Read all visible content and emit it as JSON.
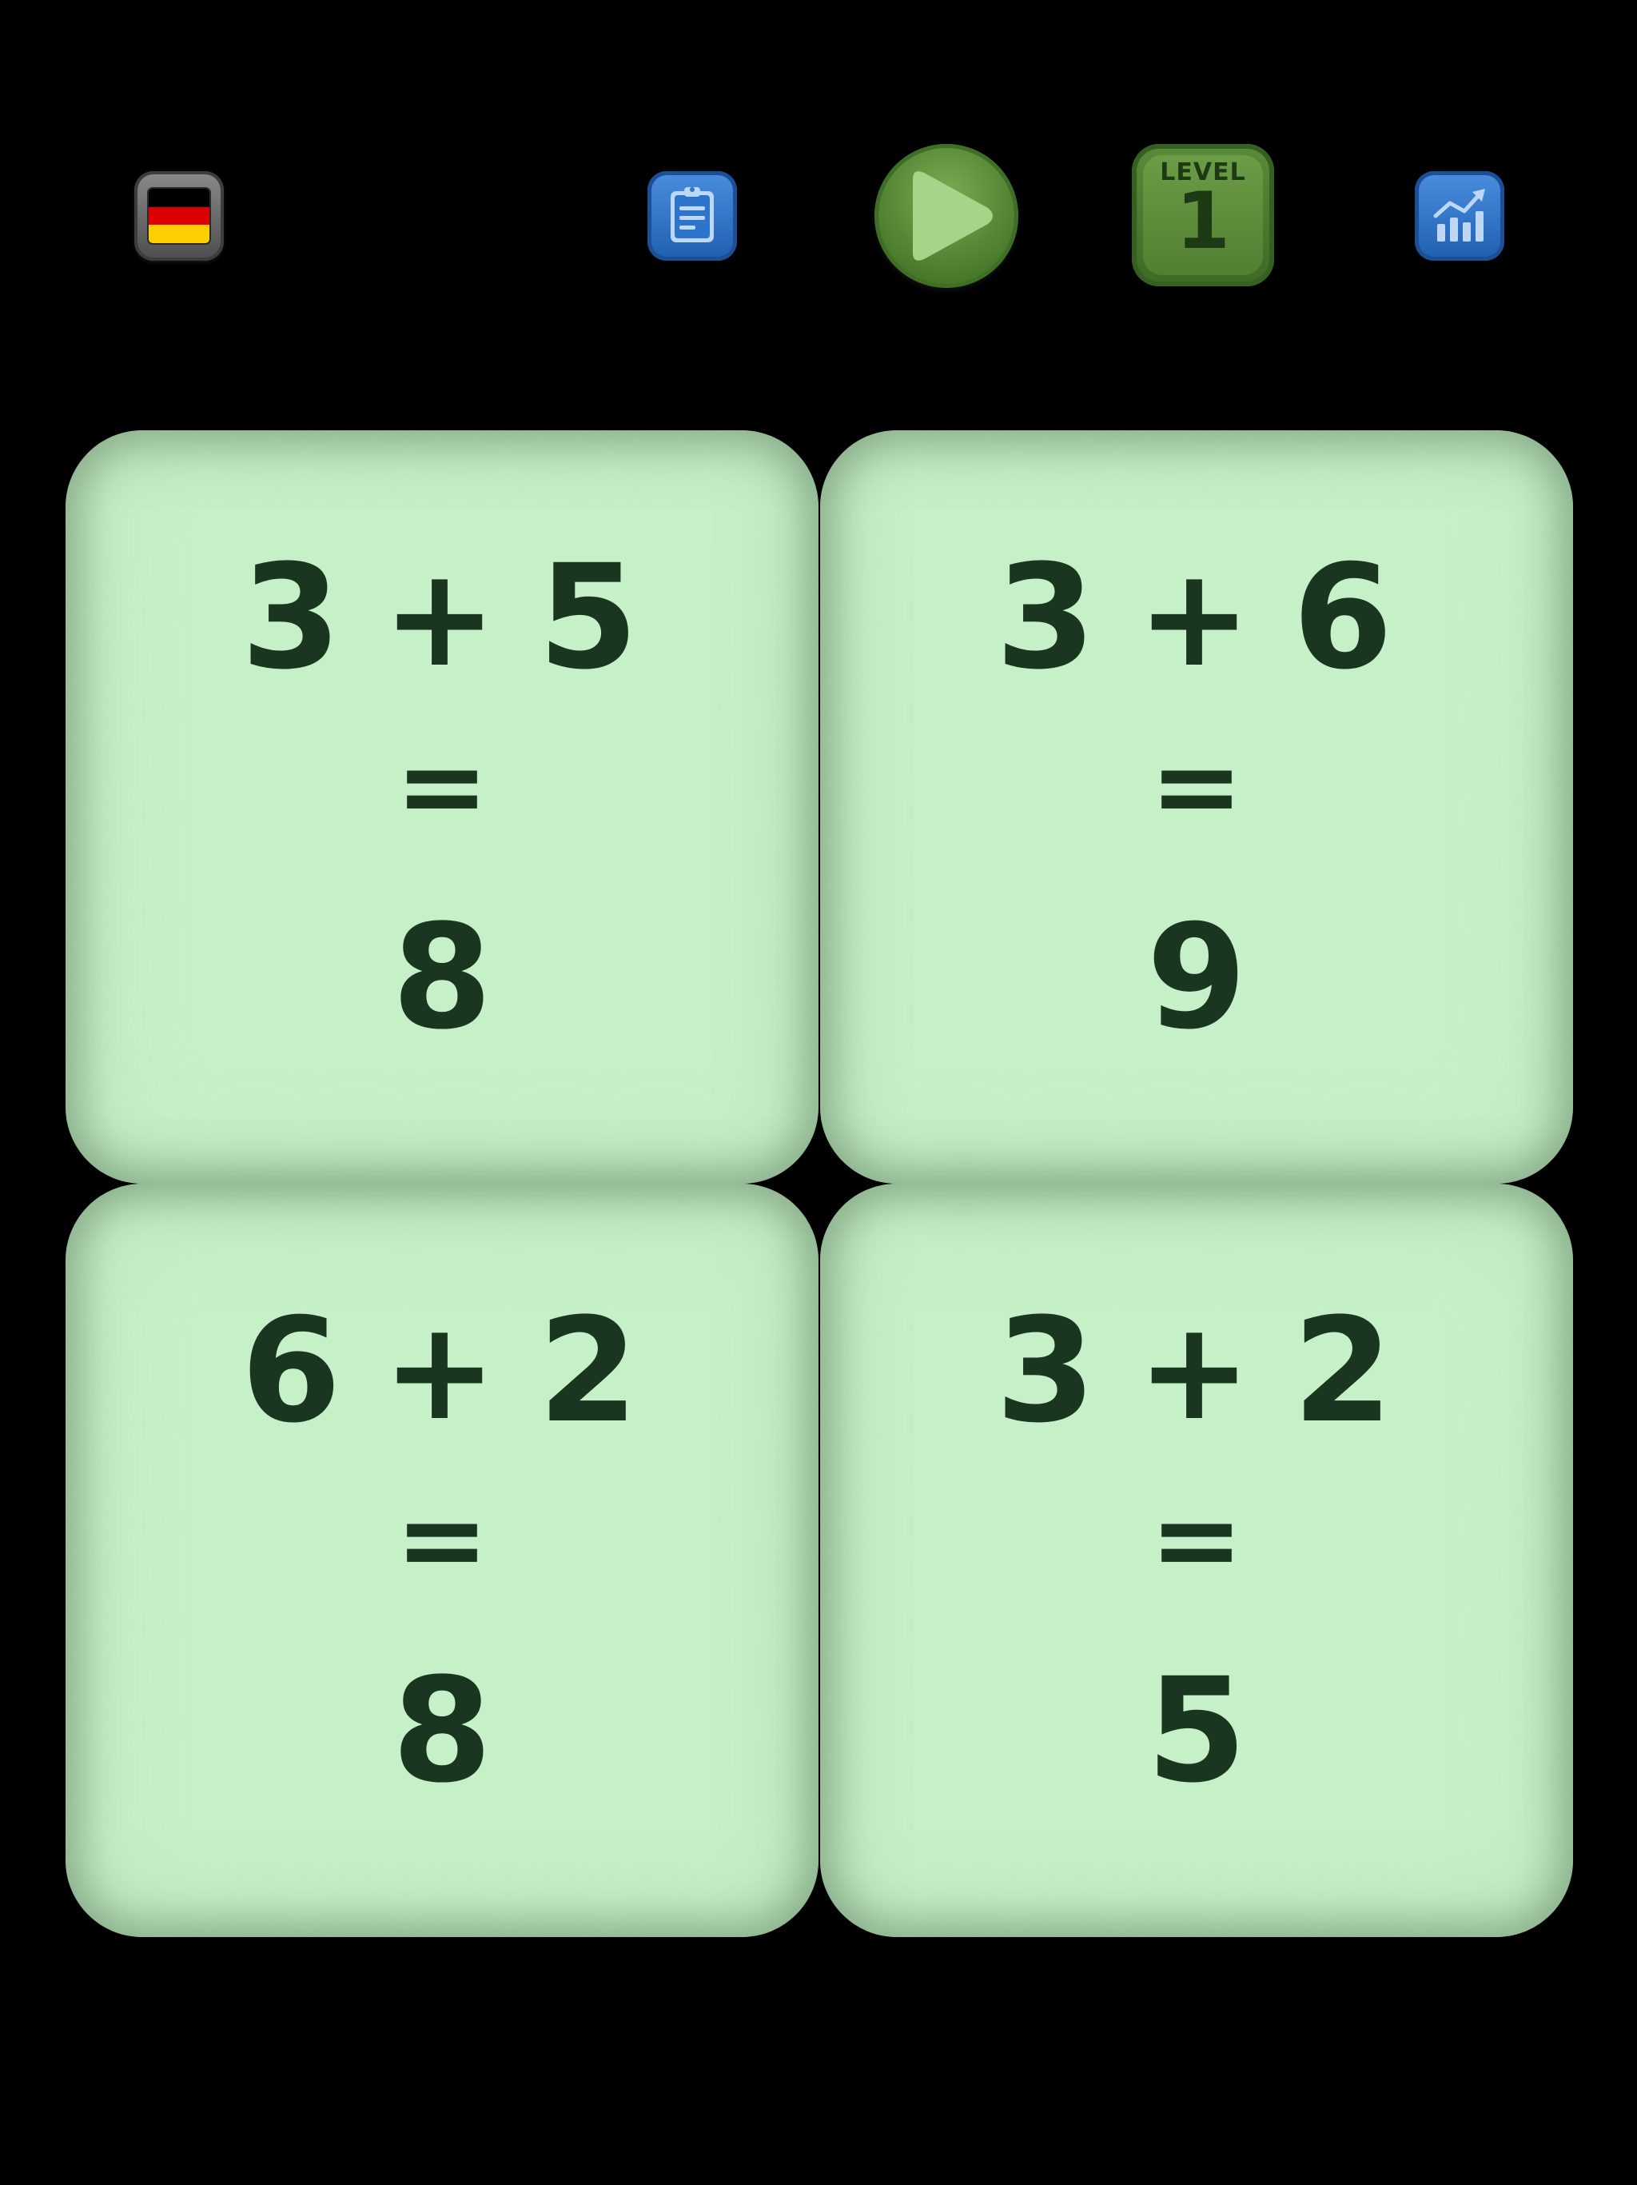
{
  "toolbar": {
    "language_flag": "germany-flag",
    "flag_colors": [
      "#000000",
      "#dd0000",
      "#ffce00"
    ],
    "list_icon": "clipboard-icon",
    "play_icon": "play-icon",
    "stats_icon": "chart-growth-icon",
    "level": {
      "label": "LEVEL",
      "number": "1"
    }
  },
  "colors": {
    "card_fill": "#c6f0c8",
    "card_text": "#1b3620",
    "play_green": "#5a8a3a",
    "button_blue": "#2f74cc"
  },
  "cards": [
    {
      "left": "3",
      "operator": "+",
      "right": "5",
      "equals": "=",
      "result": "8"
    },
    {
      "left": "3",
      "operator": "+",
      "right": "6",
      "equals": "=",
      "result": "9"
    },
    {
      "left": "6",
      "operator": "+",
      "right": "2",
      "equals": "=",
      "result": "8"
    },
    {
      "left": "3",
      "operator": "+",
      "right": "2",
      "equals": "=",
      "result": "5"
    }
  ]
}
